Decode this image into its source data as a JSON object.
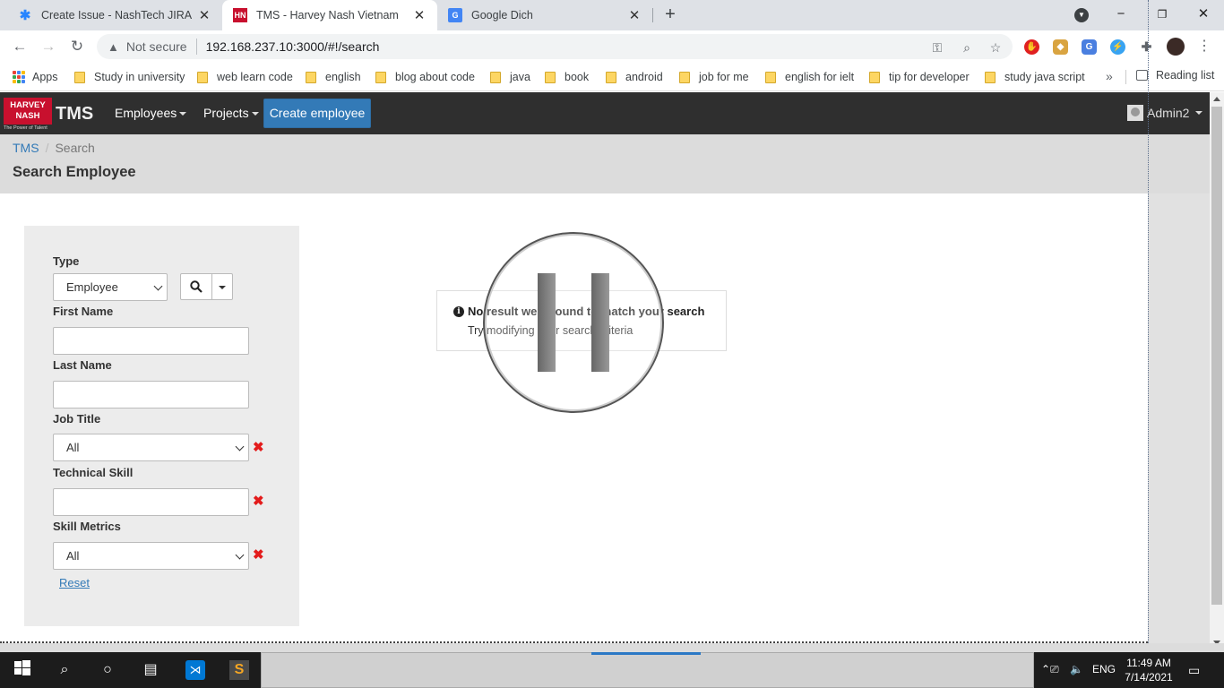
{
  "browser": {
    "tabs": [
      {
        "title": "Create Issue - NashTech JIRA",
        "active": false
      },
      {
        "title": "TMS - Harvey Nash Vietnam",
        "active": true
      },
      {
        "title": "Google Dich",
        "active": false
      }
    ],
    "favicon_hn": "HN",
    "address": {
      "security_text": "Not secure",
      "url": "192.168.237.10:3000/#!/search"
    },
    "bookmarks": {
      "apps": "Apps",
      "items": [
        "Study in university",
        "web learn code",
        "english",
        "blog about code",
        "java",
        "book",
        "android",
        "job for me",
        "english for ielt",
        "tip for developer",
        "study java script"
      ],
      "more": "»",
      "reading_list": "Reading list"
    }
  },
  "app": {
    "logo": {
      "line1": "HARVEY",
      "line2": "NASH",
      "tagline": "The Power of Talent"
    },
    "brand": "TMS",
    "nav": {
      "employees": "Employees",
      "projects": "Projects",
      "create_employee": "Create employee",
      "user": "Admin2"
    },
    "breadcrumb": {
      "home": "TMS",
      "current": "Search"
    },
    "page_title": "Search Employee",
    "form": {
      "type_label": "Type",
      "type_value": "Employee",
      "first_name_label": "First Name",
      "first_name_value": "",
      "last_name_label": "Last Name",
      "last_name_value": "",
      "job_title_label": "Job Title",
      "job_title_value": "All",
      "technical_skill_label": "Technical Skill",
      "technical_skill_value": "",
      "skill_metrics_label": "Skill Metrics",
      "skill_metrics_value": "All",
      "clear_mark": "✖",
      "reset_label": "Reset"
    },
    "no_result": {
      "info_glyph": "i",
      "title": "No result were found to match your search",
      "subtitle": "Try modifying your search criteria"
    }
  },
  "taskbar": {
    "language": "ENG",
    "time": "11:49 AM",
    "date": "7/14/2021"
  },
  "colors": {
    "navbar": "#2f2f2f",
    "primary_button": "#337ab7",
    "brand_red": "#c8102e",
    "clear_red": "#e31b1b",
    "header_grey": "#dcdcdc"
  }
}
